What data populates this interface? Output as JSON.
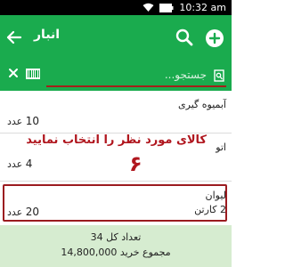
{
  "status_bar": {
    "time": "10:32 am",
    "icons": [
      "wifi-icon",
      "battery-icon"
    ]
  },
  "app_bar": {
    "title": "انبار",
    "back_icon": "back-arrow-icon",
    "search_icon": "search-icon",
    "add_icon": "add-circle-icon",
    "color": "#1aab4e"
  },
  "search": {
    "placeholder": "جستجو...",
    "value": "",
    "clear_icon": "close-icon",
    "barcode_icon": "barcode-icon",
    "underline_color": "#a3201a"
  },
  "items": [
    {
      "name": "آبمیوه گیری",
      "quantity": "10",
      "unit": "عدد"
    },
    {
      "name": "اتو",
      "quantity": "4",
      "unit": "عدد"
    },
    {
      "name": "لیوان",
      "quantity": "20",
      "unit": "عدد",
      "package": "2 کارتن"
    }
  ],
  "annotation": {
    "message": "کالای مورد نظر را انتخاب نمایید",
    "step_number": "۶",
    "color": "#b0161e"
  },
  "footer": {
    "total_count_label": "تعداد کل 34",
    "total_purchase_label": "مجموع خرید 14,800,000",
    "background": "#d6ecd0"
  }
}
